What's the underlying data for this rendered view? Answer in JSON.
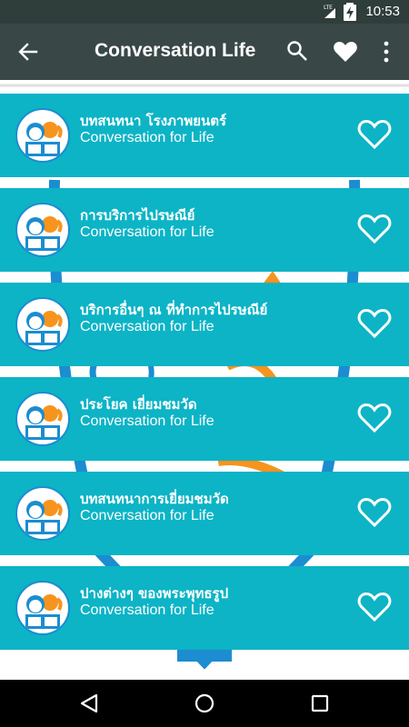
{
  "status_bar": {
    "network": "LTE",
    "time": "10:53",
    "icons": [
      "lte-signal-icon",
      "battery-charging-icon"
    ]
  },
  "toolbar": {
    "title": "Conversation Life",
    "icons": [
      "back-arrow-icon",
      "search-icon",
      "heart-icon",
      "more-vertical-icon"
    ]
  },
  "list": {
    "items": [
      {
        "title": "บทสนทนา โรงภาพยนตร์",
        "subtitle": "Conversation for Life"
      },
      {
        "title": "การบริการไปรษณีย์",
        "subtitle": "Conversation for Life"
      },
      {
        "title": "บริการอื่นๆ ณ ที่ทำการไปรษณีย์",
        "subtitle": "Conversation for Life"
      },
      {
        "title": "ประโยค เยี่ยมชมวัด",
        "subtitle": "Conversation for Life"
      },
      {
        "title": "บทสนทนาการเยี่ยมชมวัด",
        "subtitle": "Conversation for Life"
      },
      {
        "title": "ปางต่างๆ ของพระพุทธรูป",
        "subtitle": "Conversation for Life"
      }
    ]
  },
  "colors": {
    "status_bar": "#2f3d3b",
    "toolbar": "#394847",
    "row": "#0cb4c6",
    "accent_blue": "#1b8dd0",
    "accent_orange": "#f7941d"
  },
  "nav_bar": {
    "icons": [
      "back-triangle-icon",
      "home-circle-icon",
      "recents-square-icon"
    ]
  }
}
